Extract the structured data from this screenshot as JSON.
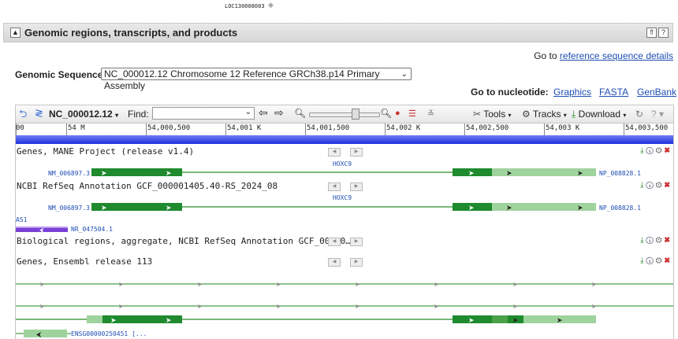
{
  "top_remnant": {
    "text": "LOC130008003"
  },
  "section": {
    "collapse_symbol": "▲",
    "title": "Genomic regions, transcripts, and products",
    "btn_expand": "⇑",
    "btn_help": "?"
  },
  "goto_ref": {
    "prefix": "Go to ",
    "link": "reference sequence details"
  },
  "genomic_sequence": {
    "label": "Genomic Sequence:",
    "selected": "NC_000012.12 Chromosome 12 Reference GRCh38.p14 Primary Assembly"
  },
  "goto_nucleotide": {
    "label": "Go to nucleotide:",
    "links": [
      "Graphics",
      "FASTA",
      "GenBank"
    ]
  },
  "toolbar": {
    "accession": "NC_000012.12",
    "find_label": "Find:",
    "find_value": "",
    "tools": "Tools",
    "tracks": "Tracks",
    "download": "Download"
  },
  "ruler": {
    "ticks": [
      "00",
      "54 M",
      "54,000,500",
      "54,001 K",
      "54,001,500",
      "54,002 K",
      "54,002,500",
      "54,003 K",
      "54,003,500"
    ]
  },
  "tracks": {
    "mane": {
      "title": "Genes, MANE Project (release v1.4)",
      "gene": "HOXC9",
      "transcript": "NM_006897.3",
      "protein": "NP_008828.1"
    },
    "refseq": {
      "title": "NCBI RefSeq Annotation GCF_000001405.40-RS_2024_08",
      "gene": "HOXC9",
      "transcript": "NM_006897.3",
      "protein": "NP_008828.1",
      "extra_gene": "AS1",
      "extra_transcript": "NR_047504.1"
    },
    "bio": {
      "title": "Biological regions, aggregate, NCBI RefSeq Annotation GCF_00000…"
    },
    "ensembl": {
      "title": "Genes, Ensembl release 113",
      "transcript": "ENSG00000250451 [..."
    }
  },
  "colors": {
    "blue_link": "#1f4eb4",
    "exon_dark": "#1f8a2e",
    "exon_light": "#9fd39d",
    "intron": "#4aa14a",
    "ncrna": "#7a3fd4"
  }
}
